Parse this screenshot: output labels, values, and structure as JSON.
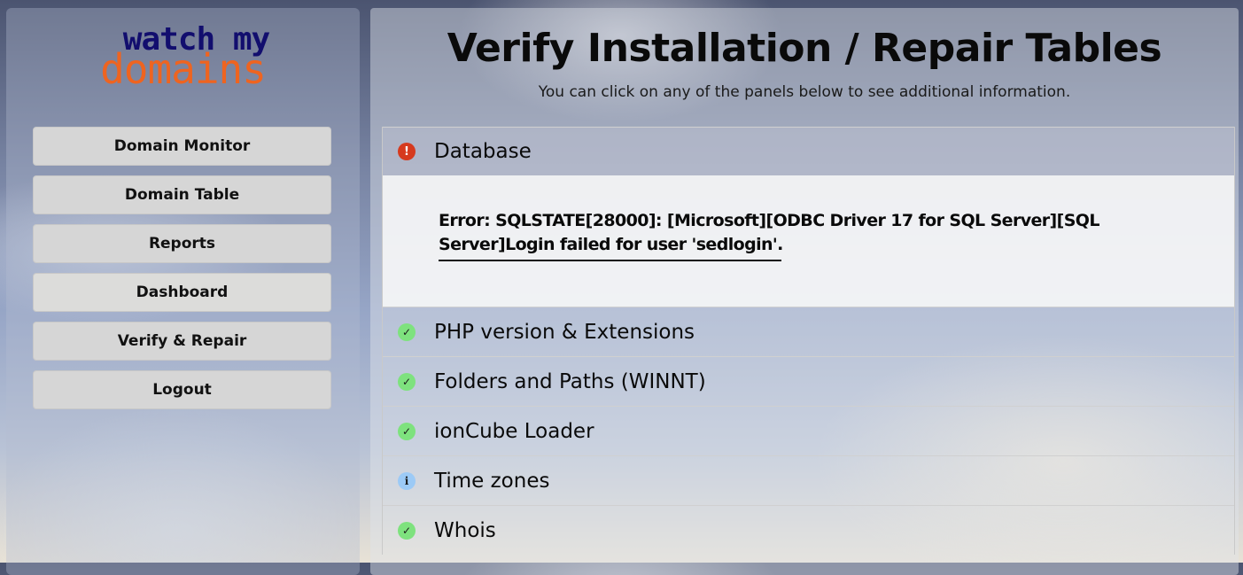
{
  "logo": {
    "line1": "watch my",
    "line2": "domains"
  },
  "sidebar": {
    "items": [
      {
        "label": "Domain Monitor"
      },
      {
        "label": "Domain Table"
      },
      {
        "label": "Reports"
      },
      {
        "label": "Dashboard"
      },
      {
        "label": "Verify & Repair"
      },
      {
        "label": "Logout"
      }
    ]
  },
  "main": {
    "title": "Verify Installation / Repair Tables",
    "subtitle": "You can click on any of the panels below to see additional information.",
    "panels": [
      {
        "label": "Database",
        "status": "error",
        "icon": "exclamation-icon",
        "icon_glyph": "!",
        "expanded": true,
        "message": "Error: SQLSTATE[28000]: [Microsoft][ODBC Driver 17 for SQL Server][SQL Server]Login failed for user 'sedlogin'."
      },
      {
        "label": "PHP version & Extensions",
        "status": "ok",
        "icon": "check-icon",
        "icon_glyph": "✓"
      },
      {
        "label": "Folders and Paths (WINNT)",
        "status": "ok",
        "icon": "check-icon",
        "icon_glyph": "✓"
      },
      {
        "label": "ionCube Loader",
        "status": "ok",
        "icon": "check-icon",
        "icon_glyph": "✓"
      },
      {
        "label": "Time zones",
        "status": "info",
        "icon": "info-icon",
        "icon_glyph": "i"
      },
      {
        "label": "Whois",
        "status": "ok",
        "icon": "check-icon",
        "icon_glyph": "✓"
      }
    ]
  },
  "colors": {
    "error": "#d63a1e",
    "ok": "#7ee27e",
    "info": "#9ccaf6",
    "logo_top": "#120e6e",
    "logo_bottom": "#ee6420"
  }
}
